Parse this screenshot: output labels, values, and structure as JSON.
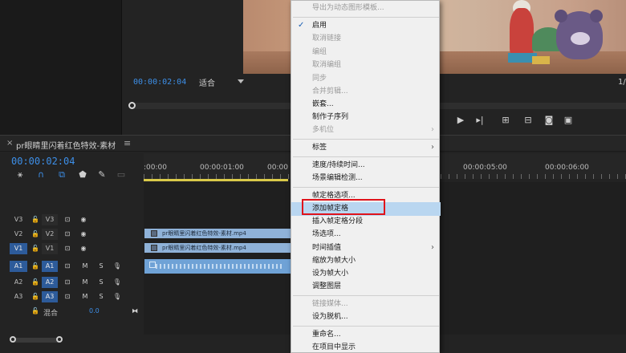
{
  "program": {
    "timecode": "00:00:02:04",
    "fit": "适合",
    "ratio": "1/"
  },
  "timeline": {
    "title": "pr眼睛里闪着红色特效-素材",
    "timecode": "00:00:02:04",
    "ruler_labels": [
      ":00:00",
      "00:00:01:00",
      "00:00",
      "00:00:05:00",
      "00:00:06:00"
    ],
    "tracks": [
      {
        "src": "V3",
        "trk": "V3",
        "src_active": false,
        "trk_active": false,
        "kind": "video"
      },
      {
        "src": "V2",
        "trk": "V2",
        "src_active": false,
        "trk_active": false,
        "kind": "video"
      },
      {
        "src": "V1",
        "trk": "V1",
        "src_active": true,
        "trk_active": false,
        "kind": "video"
      },
      {
        "src": "A1",
        "trk": "A1",
        "src_active": true,
        "trk_active": true,
        "kind": "audio"
      },
      {
        "src": "A2",
        "trk": "A2",
        "src_active": false,
        "trk_active": true,
        "kind": "audio"
      },
      {
        "src": "A3",
        "trk": "A3",
        "src_active": false,
        "trk_active": true,
        "kind": "audio"
      }
    ],
    "clip_v2": "pr眼睛里闪着红色特效-素材.mp4",
    "clip_v1": "pr眼睛里闪着红色特效-素材.mp4",
    "mix_label": "混合",
    "mix_value": "0.0",
    "icons": {
      "mute": "M",
      "solo": "S"
    }
  },
  "context_menu": {
    "items": [
      {
        "label": "导出为动态图形模板...",
        "disabled": true
      },
      {
        "label": "启用",
        "checked": true
      },
      {
        "label": "取消链接",
        "disabled": true
      },
      {
        "label": "编组",
        "disabled": true
      },
      {
        "label": "取消编组",
        "disabled": true
      },
      {
        "label": "同步",
        "disabled": true
      },
      {
        "label": "合并剪辑...",
        "disabled": true
      },
      {
        "label": "嵌套..."
      },
      {
        "label": "制作子序列"
      },
      {
        "label": "多机位",
        "disabled": true,
        "submenu": true
      },
      {
        "label": "标签",
        "submenu": true
      },
      {
        "label": "速度/持续时间..."
      },
      {
        "label": "场景编辑检测..."
      },
      {
        "label": "帧定格选项..."
      },
      {
        "label": "添加帧定格",
        "hover": true
      },
      {
        "label": "插入帧定格分段"
      },
      {
        "label": "场选项..."
      },
      {
        "label": "时间插值",
        "submenu": true
      },
      {
        "label": "缩放为帧大小"
      },
      {
        "label": "设为帧大小"
      },
      {
        "label": "调整图层"
      },
      {
        "label": "链接媒体...",
        "disabled": true
      },
      {
        "label": "设为脱机..."
      },
      {
        "label": "重命名..."
      },
      {
        "label": "在项目中显示"
      }
    ]
  },
  "colors": {
    "accent_blue": "#3d8fe8",
    "highlight_red": "#e0131b",
    "menu_hover": "#b9d6f0"
  }
}
